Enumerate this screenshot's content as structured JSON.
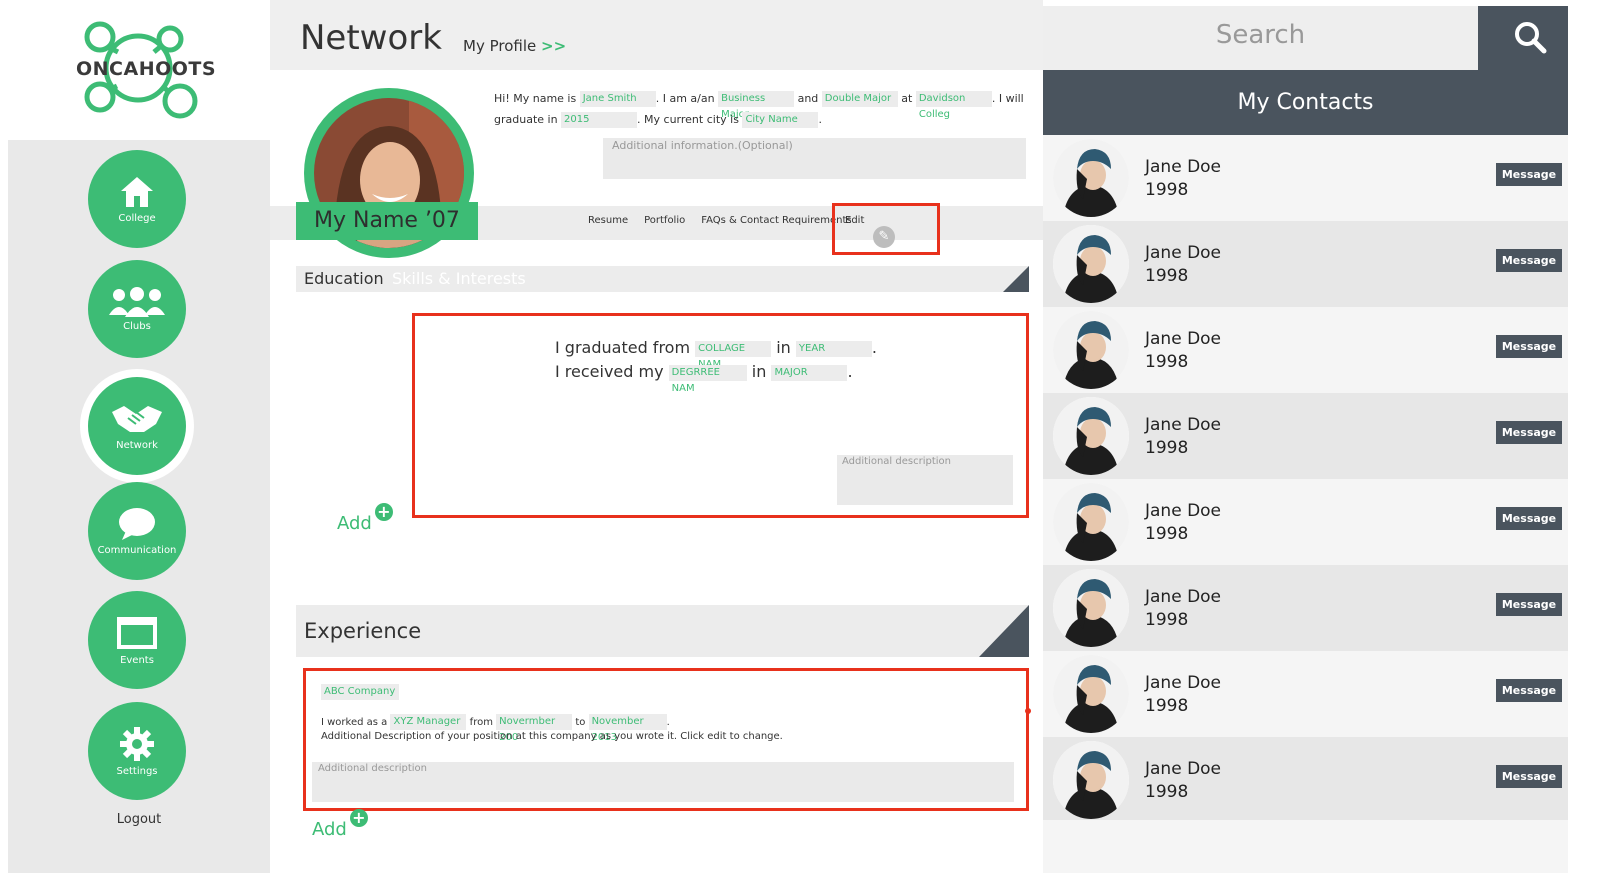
{
  "brand": {
    "name": "ONCAHOOTS",
    "color": "#3dbc75"
  },
  "sidebar": {
    "items": [
      {
        "label": "College",
        "icon": "home-icon"
      },
      {
        "label": "Clubs",
        "icon": "group-icon"
      },
      {
        "label": "Network",
        "icon": "handshake-icon",
        "active": true
      },
      {
        "label": "Communication",
        "icon": "chat-bubble-icon"
      },
      {
        "label": "Events",
        "icon": "calendar-icon"
      },
      {
        "label": "Settings",
        "icon": "gear-icon"
      }
    ],
    "logout": "Logout"
  },
  "header": {
    "title": "Network",
    "my_profile": "My Profile",
    "arrow": ">>"
  },
  "profile": {
    "name_banner": "My Name ’07",
    "bio": {
      "p1": "Hi! My name is",
      "name": "Jane Smith",
      "p2": ". I am a/an",
      "major": "Business Major",
      "p3": "and",
      "double_major": "Double Major",
      "p4": "at",
      "college": "Davidson Colleg",
      "p5": ". I will graduate in",
      "year": "2015",
      "p6": ". My current city is",
      "city": "City Name",
      "p7": "."
    },
    "additional_info_placeholder": "Additional information.(Optional)",
    "tabs": [
      "Resume",
      "Portfolio",
      "FAQs & Contact Requirements"
    ],
    "edit_label": "Edit"
  },
  "education": {
    "tab_active": "Education",
    "tab_inactive": "Skills & Interests",
    "line1_a": "I graduated from",
    "college_field": "COLLAGE NAM",
    "line1_b": "in",
    "year_field": "YEAR",
    "line1_c": ".",
    "line2_a": "I received my",
    "degree_field": "DEGRREE NAM",
    "line2_b": "in",
    "major_field": "MAJOR",
    "line2_c": ".",
    "desc_placeholder": "Additional description",
    "add_label": "Add"
  },
  "experience": {
    "title": "Experience",
    "company": "ABC Company",
    "line_a": "I worked as a",
    "position": "XYZ Manager",
    "line_b": "from",
    "from": "Novermber 200",
    "line_c": "to",
    "to": "November 2013",
    "line_d": ".",
    "line2": "Additional Description of your position at this company as you wrote it. Click edit to change.",
    "desc_placeholder": "Additional description",
    "add_label": "Add"
  },
  "search": {
    "placeholder": "Search"
  },
  "contacts": {
    "title": "My Contacts",
    "message_label": "Message",
    "items": [
      {
        "name": "Jane Doe",
        "year": "1998"
      },
      {
        "name": "Jane Doe",
        "year": "1998"
      },
      {
        "name": "Jane Doe",
        "year": "1998"
      },
      {
        "name": "Jane Doe",
        "year": "1998"
      },
      {
        "name": "Jane Doe",
        "year": "1998"
      },
      {
        "name": "Jane Doe",
        "year": "1998"
      },
      {
        "name": "Jane Doe",
        "year": "1998"
      },
      {
        "name": "Jane Doe",
        "year": "1998"
      }
    ]
  },
  "colors": {
    "accent": "#3dbc75",
    "dark": "#4a545e",
    "highlight": "#e8311c"
  }
}
